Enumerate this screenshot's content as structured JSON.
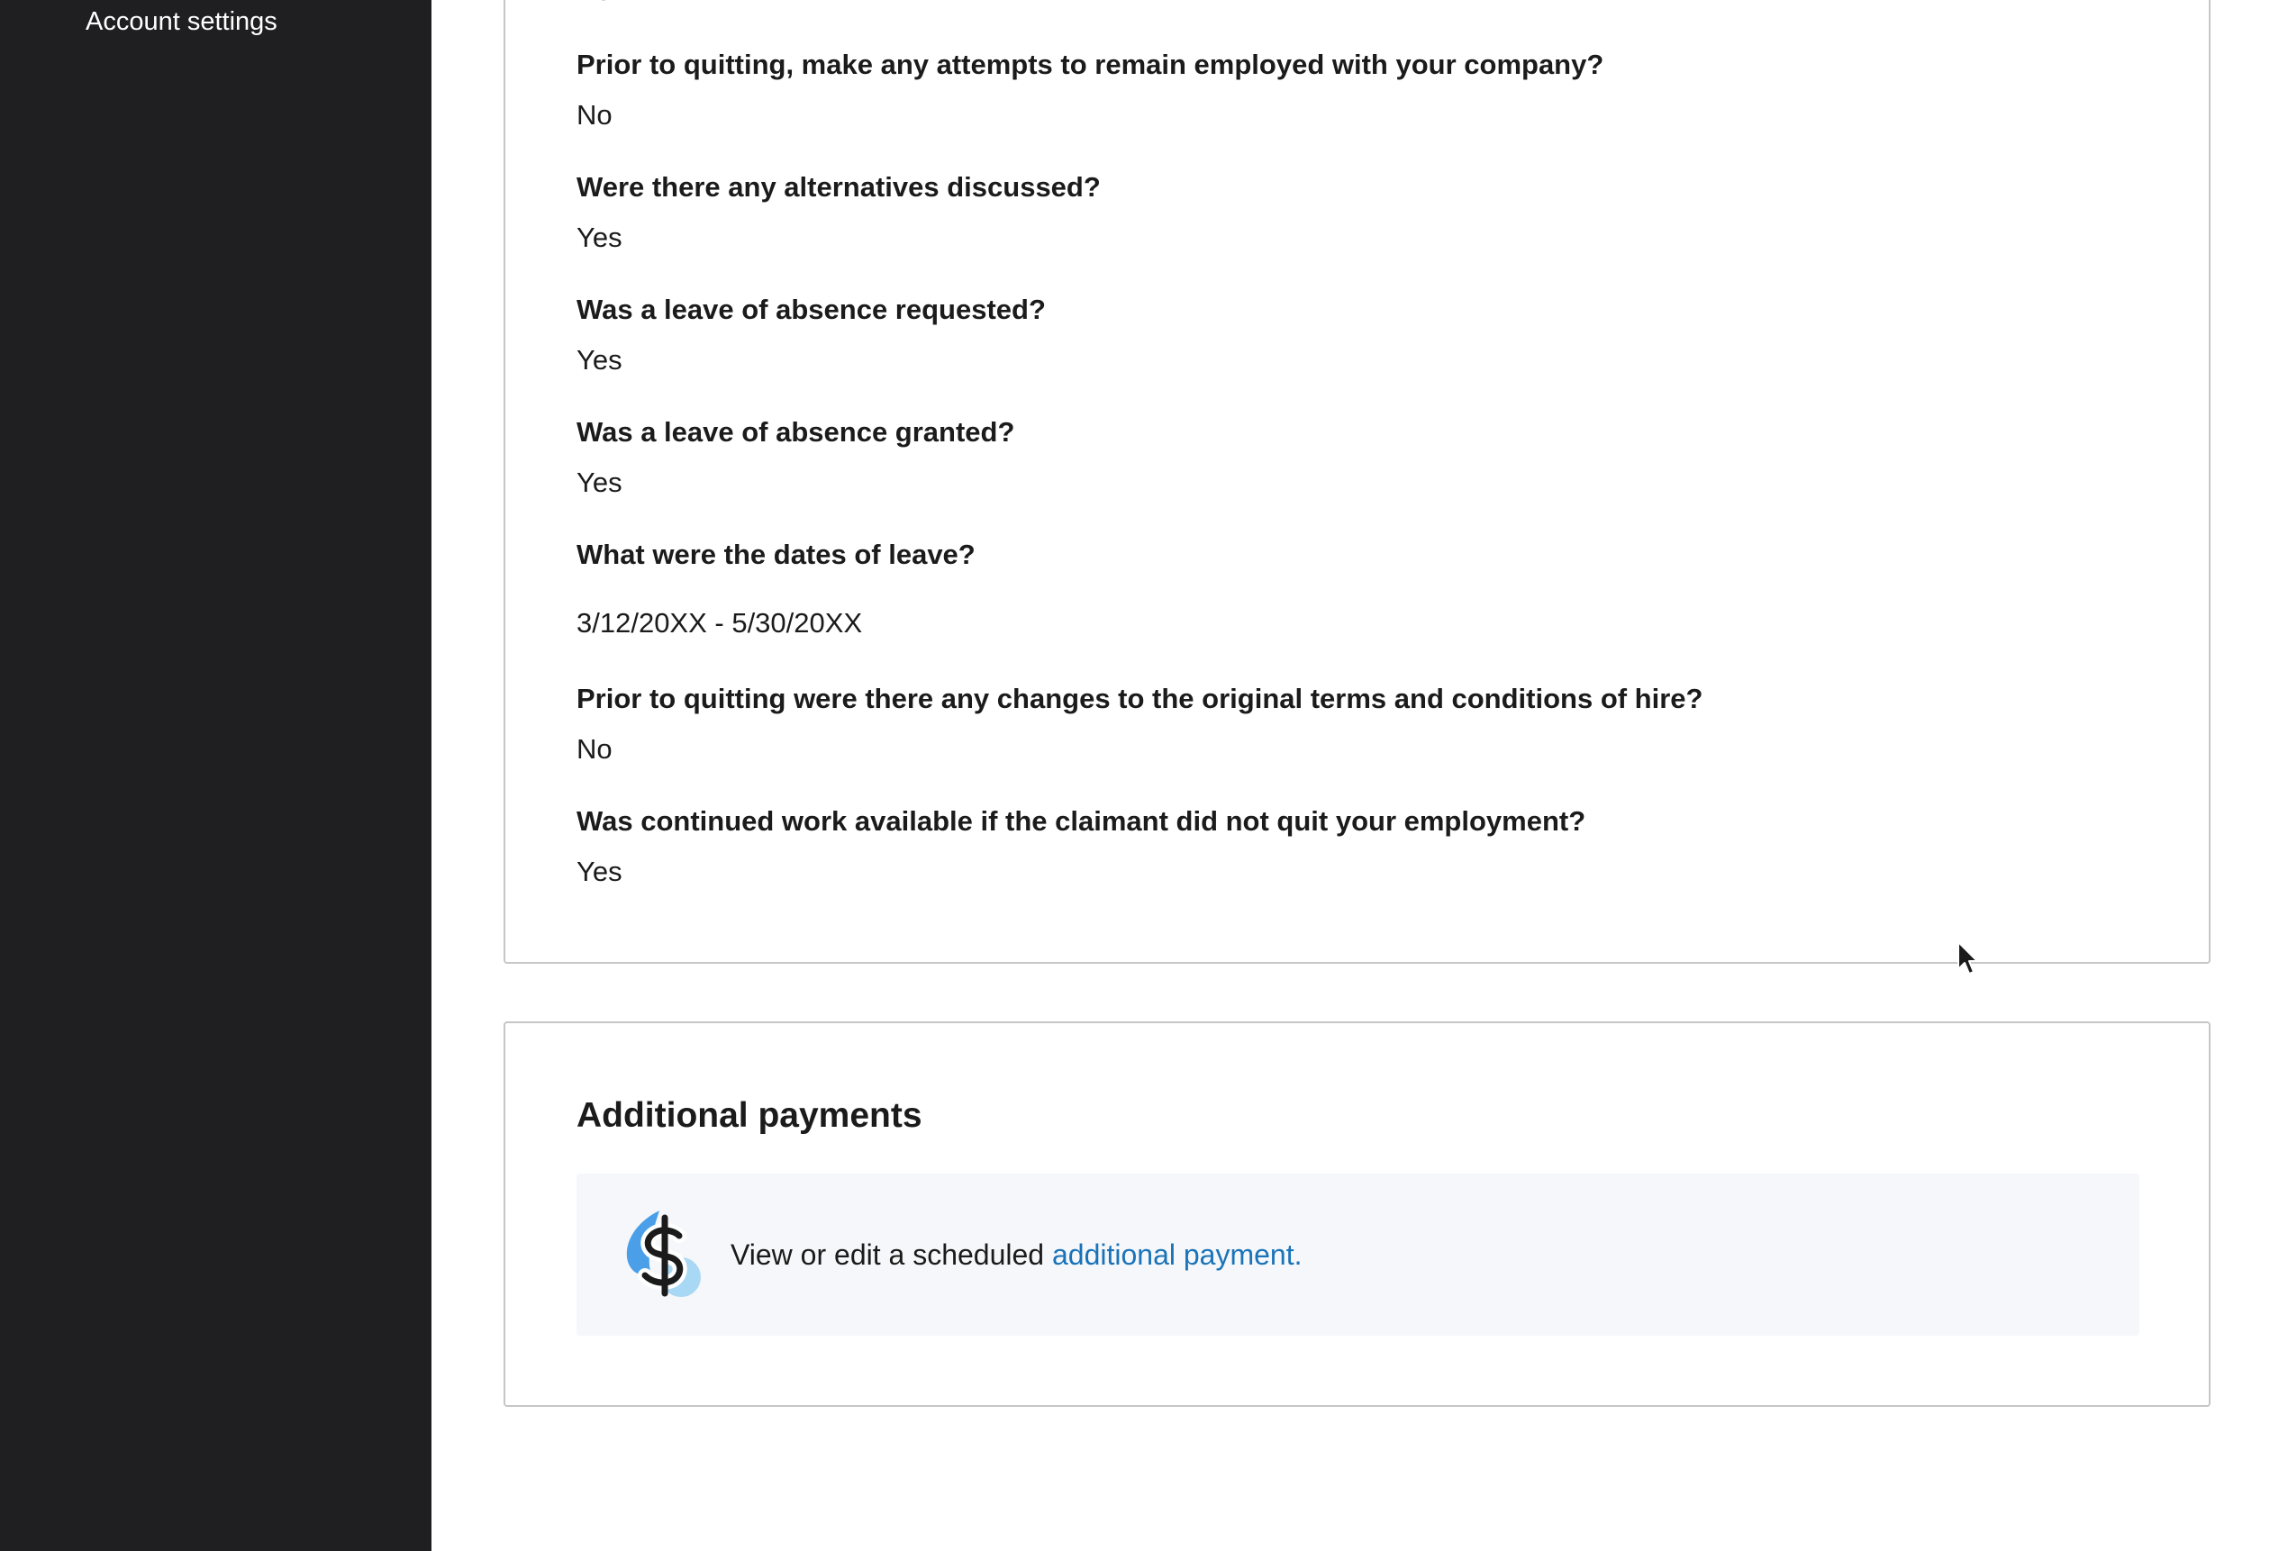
{
  "sidebar": {
    "account_settings_label": "Account settings"
  },
  "questions_card": {
    "clipped_answer": "No",
    "items": [
      {
        "question": "Prior to quitting, make any attempts to remain employed with your company?",
        "answer": "No"
      },
      {
        "question": "Were there any alternatives discussed?",
        "answer": "Yes"
      },
      {
        "question": "Was a leave of absence requested?",
        "answer": "Yes"
      },
      {
        "question": "Was a leave of absence granted?",
        "answer": "Yes"
      },
      {
        "question": "What were the dates of leave?",
        "answer": "3/12/20XX - 5/30/20XX"
      },
      {
        "question": "Prior to quitting were there any changes to the original terms and conditions of hire?",
        "answer": "No"
      },
      {
        "question": "Was continued work available if the claimant did not quit your employment?",
        "answer": "Yes"
      }
    ]
  },
  "additional_payments": {
    "title": "Additional payments",
    "text_prefix": "View or edit a scheduled ",
    "link_label": "additional payment.",
    "icon": "dollar-sign-icon"
  },
  "colors": {
    "sidebar_bg": "#1f1f21",
    "link": "#1a73b8",
    "info_box_bg": "#f5f7fa",
    "card_border": "#c6c6c6",
    "icon_blue": "#4a9fe8",
    "icon_light_blue": "#a9d8f5"
  }
}
